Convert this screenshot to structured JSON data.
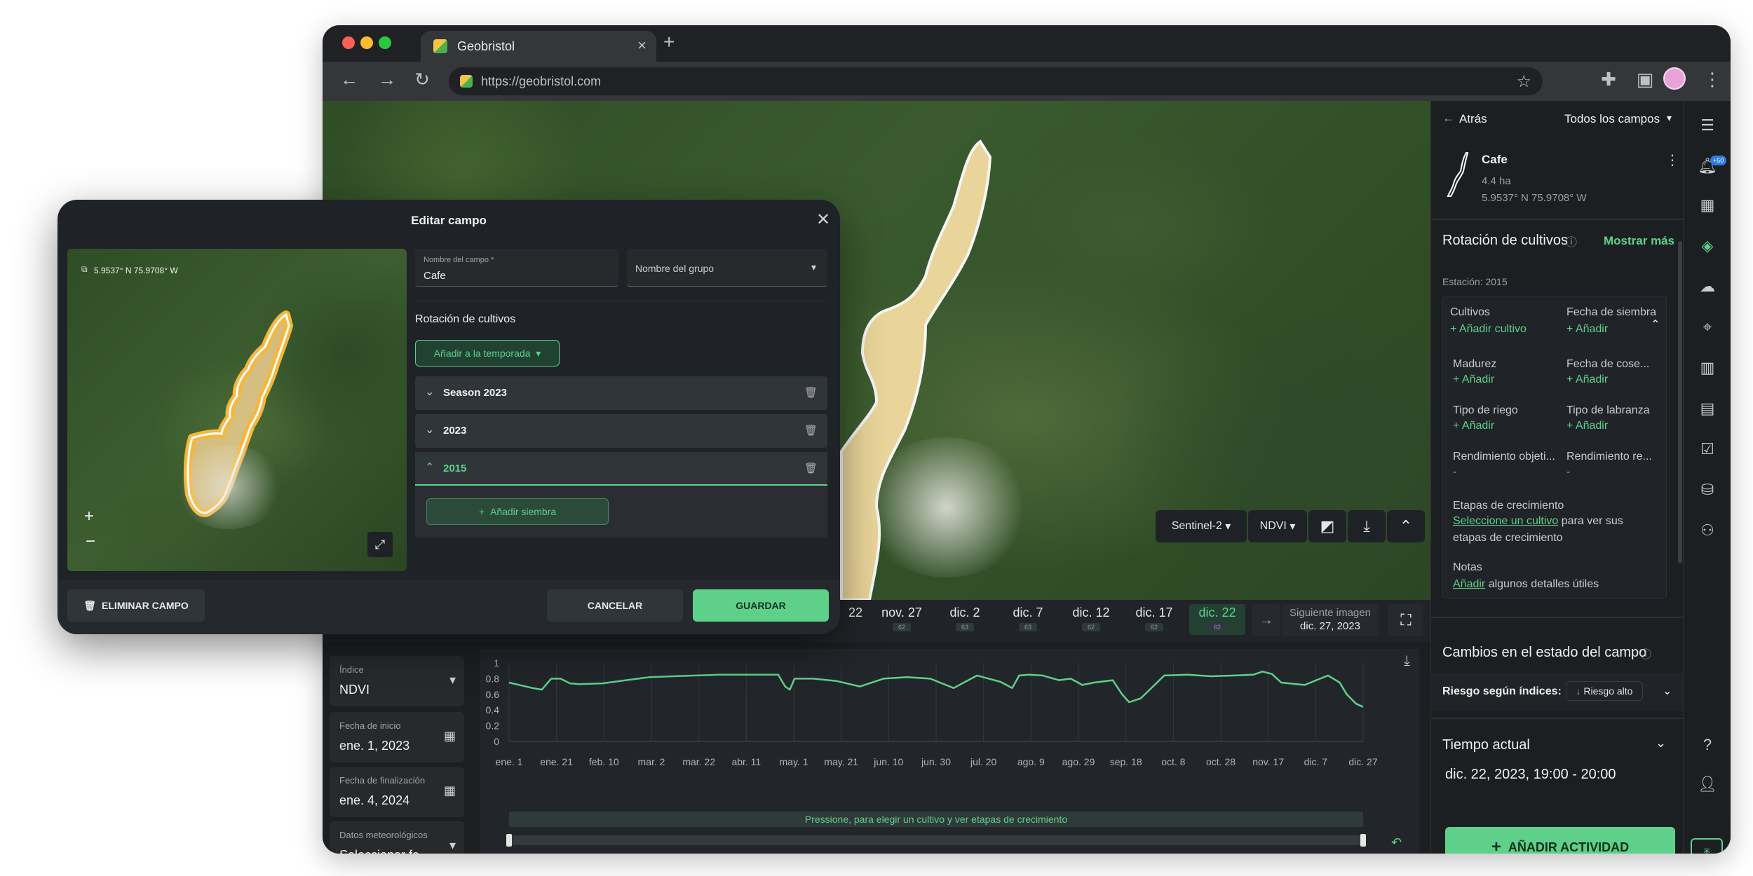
{
  "browser": {
    "tab_title": "Geobristol",
    "url": "https://geobristol.com",
    "new_tab": "+",
    "close_tab": "×"
  },
  "map": {
    "source": "Sentinel-2",
    "index": "NDVI",
    "dates": [
      {
        "d": "22",
        "p": ""
      },
      {
        "d": "nov. 27",
        "p": "62"
      },
      {
        "d": "dic. 2",
        "p": "63"
      },
      {
        "d": "dic. 7",
        "p": "63"
      },
      {
        "d": "dic. 12",
        "p": "62"
      },
      {
        "d": "dic. 17",
        "p": "62"
      },
      {
        "d": "dic. 22",
        "p": "62"
      }
    ],
    "next_label": "Siguiente imagen",
    "next_date": "dic. 27, 2023"
  },
  "bottom": {
    "index_label": "Índice",
    "index_value": "NDVI",
    "start_label": "Fecha de inicio",
    "start_value": "ene. 1, 2023",
    "end_label": "Fecha de finalización",
    "end_value": "ene. 4, 2024",
    "weather_label": "Datos meteorológicos",
    "weather_value": "Seleccionar fe...",
    "hint": "Pressione, para elegir un cultivo y ver etapas de crecimiento"
  },
  "chart_data": {
    "type": "line",
    "title": "",
    "xlabel": "",
    "ylabel": "",
    "ylim": [
      0,
      1
    ],
    "yticks": [
      "1",
      "0.8",
      "0.6",
      "0.4",
      "0.2",
      "0"
    ],
    "xticks": [
      "ene. 1",
      "ene. 21",
      "feb. 10",
      "mar. 2",
      "mar. 22",
      "abr. 11",
      "may. 1",
      "may. 21",
      "jun. 10",
      "jun. 30",
      "jul. 20",
      "ago. 9",
      "ago. 29",
      "sep. 18",
      "oct. 8",
      "oct. 28",
      "nov. 17",
      "dic. 7",
      "dic. 27"
    ],
    "series": [
      {
        "x": [
          0,
          10,
          14,
          18,
          22,
          26,
          30,
          40,
          50,
          60,
          70,
          80,
          90,
          100,
          115,
          118,
          120,
          122,
          130,
          140,
          150,
          160,
          170,
          180,
          190,
          200,
          210,
          215,
          218,
          222,
          228,
          235,
          240,
          245,
          250,
          258,
          262,
          265,
          270,
          280,
          290,
          300,
          310,
          318,
          322,
          326,
          330,
          340,
          350,
          355,
          358,
          362,
          365
        ],
        "values": [
          0.75,
          0.68,
          0.66,
          0.8,
          0.8,
          0.74,
          0.73,
          0.74,
          0.78,
          0.82,
          0.83,
          0.84,
          0.85,
          0.85,
          0.85,
          0.7,
          0.66,
          0.8,
          0.8,
          0.77,
          0.7,
          0.8,
          0.82,
          0.8,
          0.68,
          0.84,
          0.76,
          0.68,
          0.84,
          0.85,
          0.84,
          0.78,
          0.8,
          0.72,
          0.75,
          0.78,
          0.6,
          0.5,
          0.55,
          0.84,
          0.85,
          0.83,
          0.84,
          0.85,
          0.89,
          0.86,
          0.75,
          0.72,
          0.84,
          0.75,
          0.6,
          0.48,
          0.44
        ]
      }
    ]
  },
  "sidebar": {
    "back": "Atrás",
    "all_fields": "Todos los campos",
    "field_name": "Cafe",
    "area": "4.4 ha",
    "coords": "5.9537° N 75.9708° W",
    "rotation_title": "Rotación de cultivos",
    "show_more": "Mostrar más",
    "station": "Estación: 2015",
    "crops_label": "Cultivos",
    "add_crop": "+ Añadir cultivo",
    "sowing_label": "Fecha de siembra",
    "add": "+ Añadir",
    "maturity_label": "Madurez",
    "harvest_label": "Fecha de cose...",
    "irrigation_label": "Tipo de riego",
    "tillage_label": "Tipo de labranza",
    "target_yield_label": "Rendimiento objeti...",
    "yield_label": "Rendimiento re...",
    "dash": "-",
    "growth_label": "Etapas de crecimiento",
    "growth_link": "Seleccione un cultivo",
    "growth_rest": " para ver sus",
    "growth_rest2": "etapas de crecimiento",
    "notes_label": "Notas",
    "notes_link": "Añadir",
    "notes_rest": " algunos detalles útiles",
    "status_title": "Cambios en el estado del campo",
    "risk_label": "Riesgo según índices:",
    "risk_value": "Riesgo alto",
    "weather_title": "Tiempo actual",
    "weather_time": "dic. 22, 2023, 19:00 - 20:00",
    "add_activity": "AÑADIR ACTIVIDAD",
    "badge": "+50"
  },
  "modal": {
    "title": "Editar campo",
    "coords": "5.9537° N 75.9708° W",
    "name_label": "Nombre del campo *",
    "name_value": "Cafe",
    "group_label": "Nombre del grupo",
    "rotation_title": "Rotación de cultivos",
    "add_season": "Añadir a la temporada",
    "seasons": [
      "Season 2023",
      "2023",
      "2015"
    ],
    "add_sowing": "Añadir siembra",
    "delete": "ELIMINAR CAMPO",
    "cancel": "CANCELAR",
    "save": "GUARDAR",
    "zoom_in": "+",
    "zoom_out": "−"
  },
  "colors": {
    "accent": "#5fd08a",
    "save_bg": "#5fd08a",
    "field_outline": "#f6b73c",
    "field_fill": "#f3dba0"
  }
}
